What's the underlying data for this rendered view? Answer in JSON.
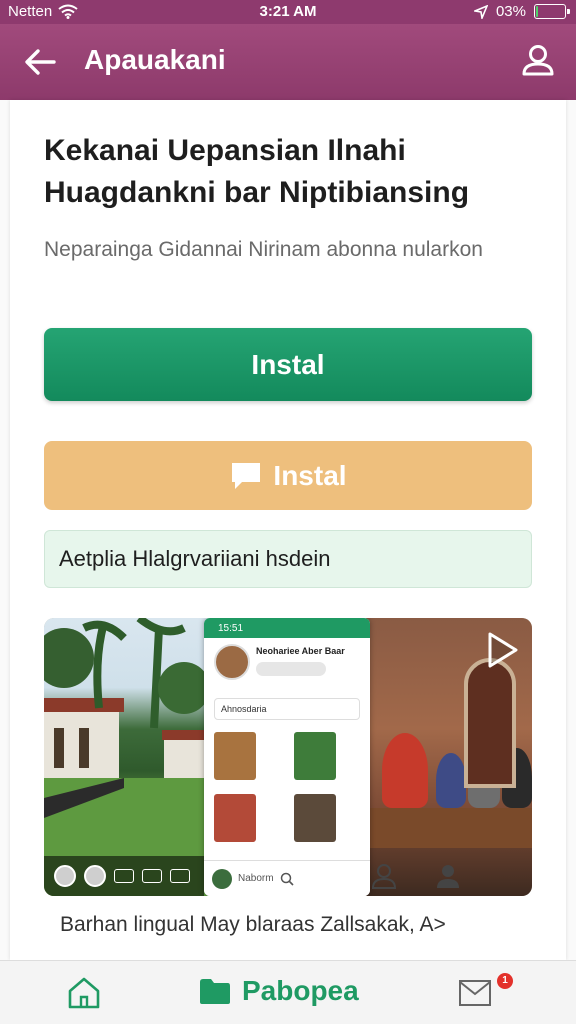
{
  "status_bar": {
    "carrier": "Netten",
    "time": "3:21 AM",
    "battery": "03%",
    "battery_level": 0.03
  },
  "app_bar": {
    "title": "Apauakani",
    "back_icon": "arrow-left-icon",
    "user_icon": "user-icon"
  },
  "content": {
    "heading": "Kekanai Uepansian Ilnahi Huagdankni bar Niptibiansing",
    "subheading": "Neparainga Gidannai Nirinam abonna nularkon",
    "primary_button": "Instal",
    "secondary_button": "Instal",
    "note": "Aetplia Hlalgrvariiani hsdein",
    "caption": "Barhan lingual May blaraas Zallsakak, A>"
  },
  "media": {
    "phone_title": "Neohariee Aber Baar",
    "phone_status": "15:51",
    "phone_row": "Ahnosdaria",
    "phone_search": "Naborm",
    "play_icon": "play-icon",
    "search_icon": "search-icon"
  },
  "bottom_nav": {
    "home_icon": "home-icon",
    "center_label": "Pabopea",
    "mail_icon": "mail-icon",
    "mail_badge": "1"
  },
  "colors": {
    "app_bar": "#8d3a6b",
    "primary": "#1a9666",
    "secondary": "#eebf7d",
    "note_bg": "#e7f6ec"
  }
}
